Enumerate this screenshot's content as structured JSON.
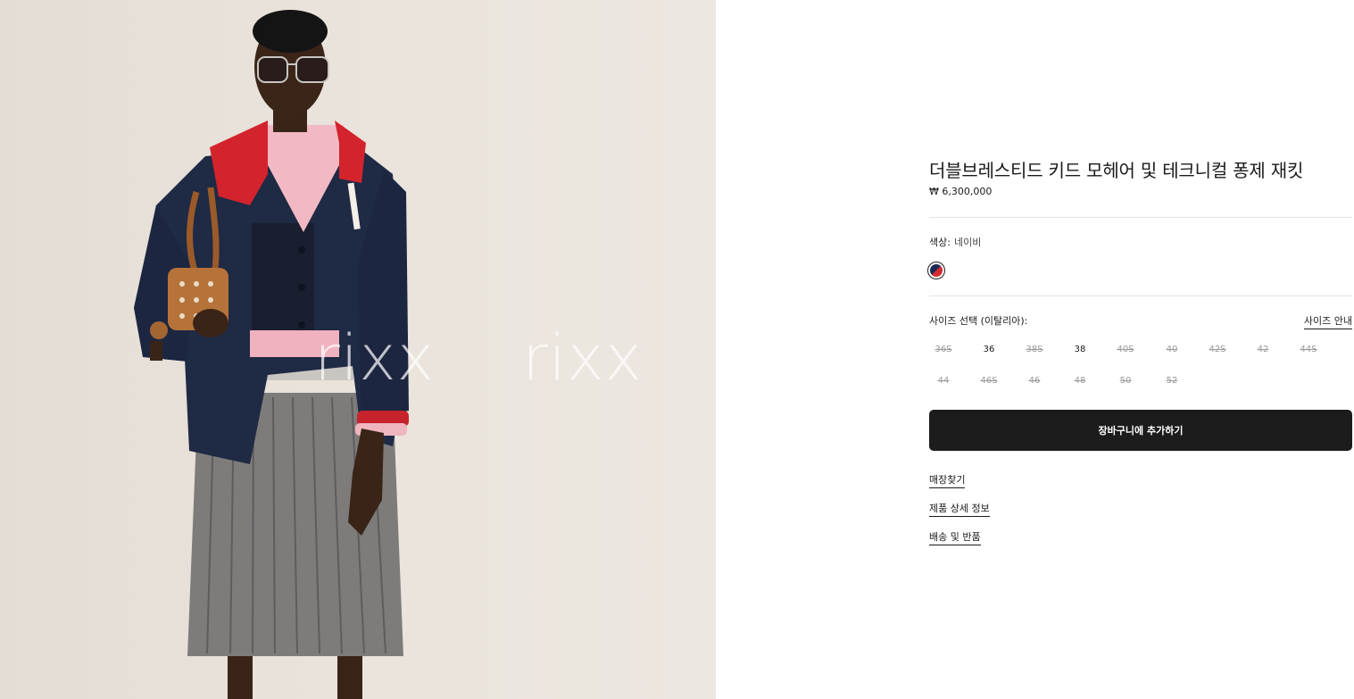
{
  "product": {
    "title": "더블브레스티드 키드 모헤어 및 테크니컬 퐁제 재킷",
    "price": "₩ 6,300,000"
  },
  "color": {
    "label": "색상:",
    "value": "네이비",
    "swatch_colors": [
      "#1b2a55",
      "#d42a31"
    ]
  },
  "size": {
    "label": "사이즈 선택 (이탈리아):",
    "guide_label": "사이즈 안내",
    "options": [
      {
        "label": "36S",
        "available": false
      },
      {
        "label": "36",
        "available": true
      },
      {
        "label": "38S",
        "available": false
      },
      {
        "label": "38",
        "available": true
      },
      {
        "label": "40S",
        "available": false
      },
      {
        "label": "40",
        "available": false
      },
      {
        "label": "42S",
        "available": false
      },
      {
        "label": "42",
        "available": false
      },
      {
        "label": "44S",
        "available": false
      },
      {
        "label": "44",
        "available": false
      },
      {
        "label": "46S",
        "available": false
      },
      {
        "label": "46",
        "available": false
      },
      {
        "label": "48",
        "available": false
      },
      {
        "label": "50",
        "available": false
      },
      {
        "label": "52",
        "available": false
      }
    ]
  },
  "actions": {
    "add_to_cart": "장바구니에 추가하기"
  },
  "links": {
    "find_store": "매장찾기",
    "product_details": "제품 상세 정보",
    "shipping_returns": "배송 및 반품"
  },
  "image": {
    "watermark_1": "rixx",
    "watermark_2": "rixx"
  }
}
